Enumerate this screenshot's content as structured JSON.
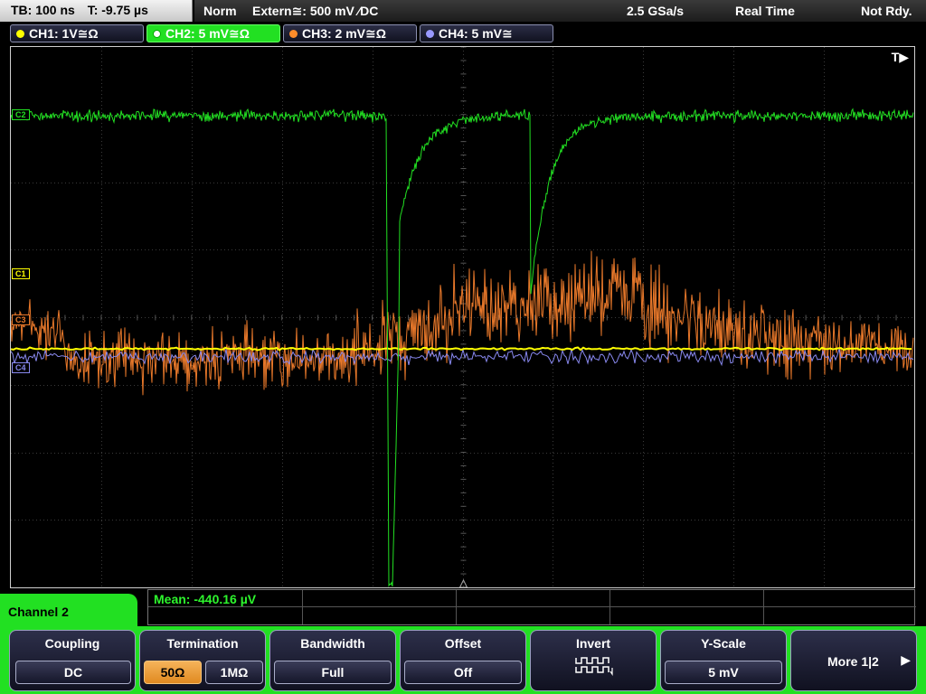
{
  "header": {
    "timebase": "TB: 100 ns",
    "trigger_time": "T: -9.75 µs",
    "acq_mode": "Norm",
    "trigger_source": "Extern≅: 500 mV ⁄DC",
    "sample_rate": "2.5 GSa/s",
    "realtime": "Real Time",
    "status": "Not Rdy."
  },
  "channels": [
    {
      "label": "CH1: 1V≅Ω",
      "color": "#ffff00",
      "active": false
    },
    {
      "label": "CH2: 5 mV≅Ω",
      "color": "#22e022",
      "active": true
    },
    {
      "label": "CH3: 2 mV≅Ω",
      "color": "#ff8c2a",
      "active": false
    },
    {
      "label": "CH4: 5 mV≅",
      "color": "#9999ff",
      "active": false
    }
  ],
  "screen": {
    "trigger_marker": "T▶",
    "ref_labels": {
      "c1": "C1",
      "c3": "C3",
      "c4": "C4",
      "c2": "C2"
    }
  },
  "measurement": {
    "text": "Mean: -440.16 µV"
  },
  "menu": {
    "title": "Channel 2",
    "softkeys": [
      {
        "title": "Coupling",
        "value": "DC"
      },
      {
        "title": "Termination",
        "options": [
          "50Ω",
          "1MΩ"
        ],
        "selected": "50Ω"
      },
      {
        "title": "Bandwidth",
        "value": "Full"
      },
      {
        "title": "Offset",
        "value": "Off"
      },
      {
        "title": "Invert",
        "icon": "invert-waveform-icon"
      },
      {
        "title": "Y-Scale",
        "value": "5 mV"
      },
      {
        "title": "More 1|2",
        "icon": "right-arrow-icon"
      }
    ]
  },
  "colors": {
    "ch1": "#ffff00",
    "ch2": "#22e022",
    "ch3": "#e8782a",
    "ch4": "#8888ee",
    "grid": "#3a3a3a"
  }
}
